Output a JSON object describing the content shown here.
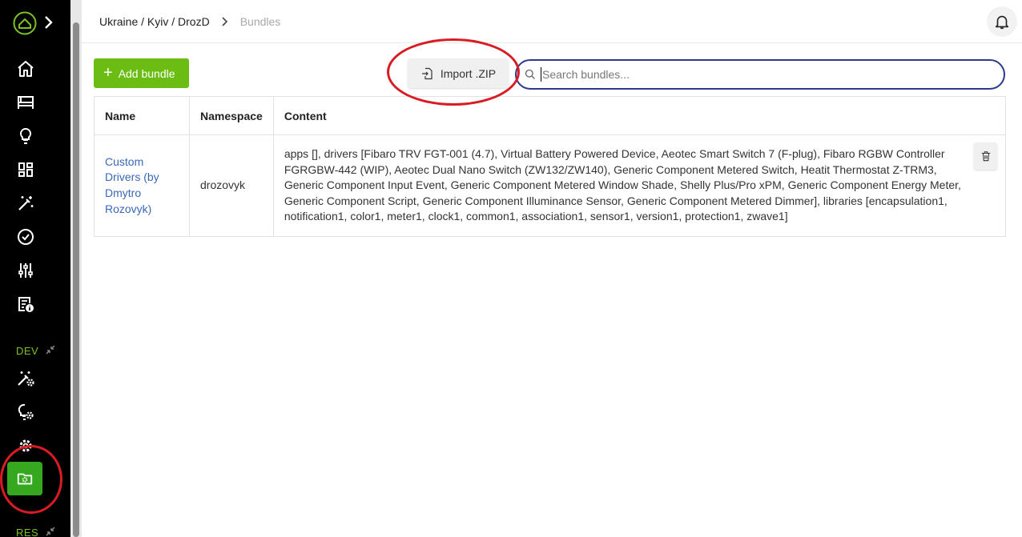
{
  "breadcrumb": {
    "path": "Ukraine / Kyiv / DrozD",
    "current": "Bundles"
  },
  "sidebar": {
    "sections": [
      {
        "label": "DEV"
      },
      {
        "label": "RES"
      }
    ],
    "icons": [
      "home-icon",
      "devices-icon",
      "bulb-icon",
      "dashboard-icon",
      "wand-icon",
      "check-circle-icon",
      "sliders-icon",
      "log-info-icon",
      "wand-gear-icon",
      "bulb-gear-icon",
      "gear-icon",
      "bundles-folder-icon"
    ]
  },
  "toolbar": {
    "add_label": "Add bundle",
    "import_label": "Import .ZIP",
    "search_placeholder": "Search bundles..."
  },
  "table": {
    "headers": {
      "name": "Name",
      "namespace": "Namespace",
      "content": "Content"
    },
    "rows": [
      {
        "name": "Custom Drivers (by Dmytro Rozovyk)",
        "namespace": "drozovyk",
        "content": "apps [], drivers [Fibaro TRV FGT-001 (4.7), Virtual Battery Powered Device, Aeotec Smart Switch 7 (F-plug), Fibaro RGBW Controller FGRGBW-442 (WIP), Aeotec Dual Nano Switch (ZW132/ZW140), Generic Component Metered Switch, Heatit Thermostat Z-TRM3, Generic Component Input Event, Generic Component Metered Window Shade, Shelly Plus/Pro xPM, Generic Component Energy Meter, Generic Component Script, Generic Component Illuminance Sensor, Generic Component Metered Dimmer], libraries [encapsulation1, notification1, color1, meter1, clock1, common1, association1, sensor1, version1, protection1, zwave1]"
      }
    ]
  },
  "colors": {
    "accent_green": "#6cbd13",
    "active_nav": "#36a81f",
    "link_blue": "#3a68b8",
    "annotation_red": "#d91c24",
    "search_border": "#2b3a8c"
  }
}
